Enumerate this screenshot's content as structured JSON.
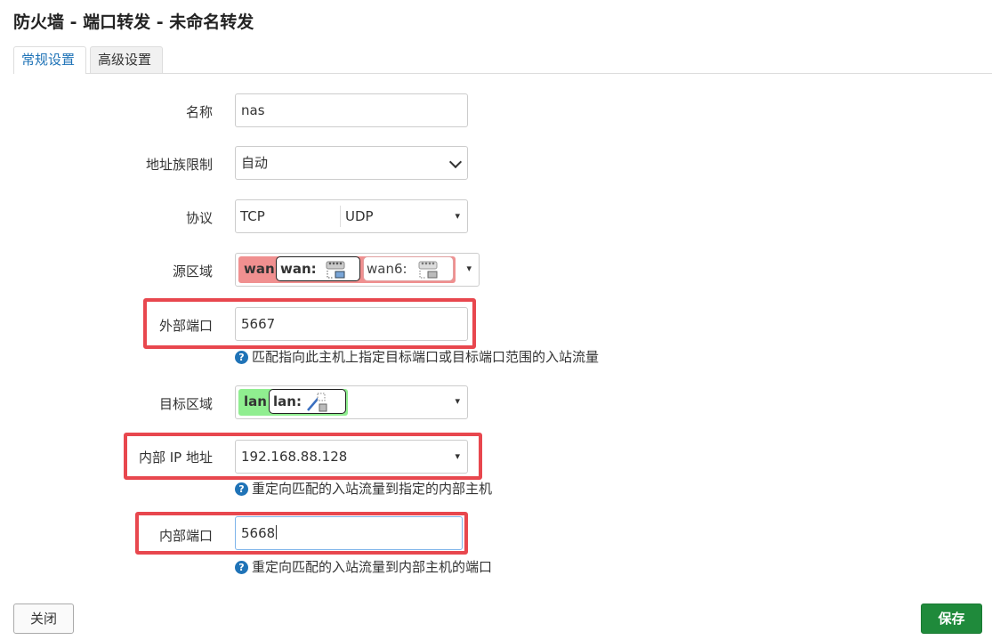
{
  "title": "防火墙 - 端口转发 - 未命名转发",
  "tabs": [
    {
      "label": "常规设置",
      "active": true
    },
    {
      "label": "高级设置",
      "active": false
    }
  ],
  "form": {
    "name": {
      "label": "名称",
      "value": "nas"
    },
    "family": {
      "label": "地址族限制",
      "value": "自动"
    },
    "protocol": {
      "label": "协议",
      "values": [
        "TCP",
        "UDP"
      ]
    },
    "src_zone": {
      "label": "源区域",
      "zone": "wan",
      "chips": [
        "wan:",
        "wan6:"
      ]
    },
    "ext_port": {
      "label": "外部端口",
      "value": "5667",
      "help": "匹配指向此主机上指定目标端口或目标端口范围的入站流量"
    },
    "dest_zone": {
      "label": "目标区域",
      "zone": "lan",
      "chips": [
        "lan:"
      ]
    },
    "internal_ip": {
      "label": "内部 IP 地址",
      "value": "192.168.88.128",
      "help": "重定向匹配的入站流量到指定的内部主机"
    },
    "internal_port": {
      "label": "内部端口",
      "value": "5668",
      "help": "重定向匹配的入站流量到内部主机的端口"
    }
  },
  "buttons": {
    "close": "关闭",
    "save": "保存"
  },
  "colors": {
    "accent": "#1f73b7",
    "save": "#1f8a3b",
    "wan_zone": "#f09090",
    "lan_zone": "#90ee90",
    "highlight": "#e8474e"
  }
}
